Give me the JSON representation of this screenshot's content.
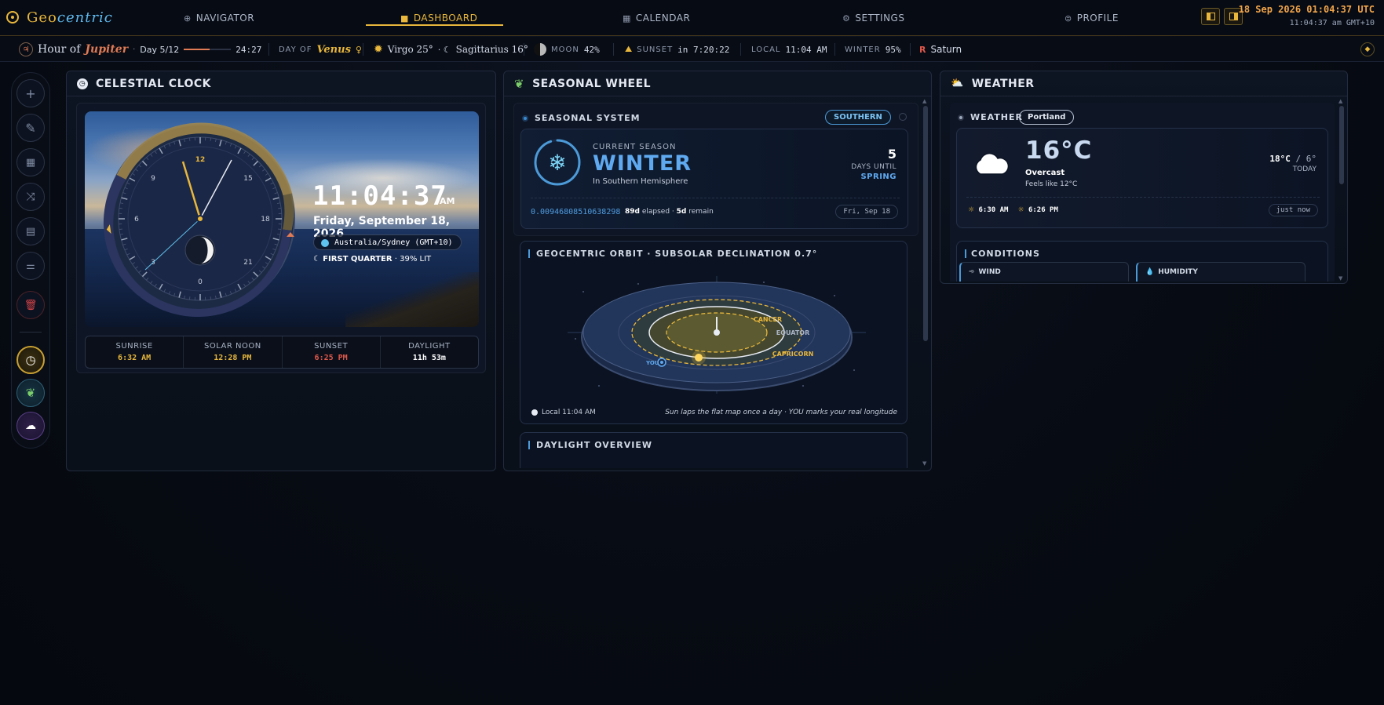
{
  "brand": {
    "part1": "Geo",
    "part2": "centric"
  },
  "nav": {
    "items": [
      {
        "label": "NAVIGATOR",
        "icon": "globe-icon"
      },
      {
        "label": "DASHBOARD",
        "icon": "dashboard-icon",
        "active": true
      },
      {
        "label": "CALENDAR",
        "icon": "calendar-icon"
      },
      {
        "label": "SETTINGS",
        "icon": "gear-icon"
      },
      {
        "label": "PROFILE",
        "icon": "profile-icon"
      }
    ],
    "utc_time": "18 Sep 2026 01:04:37 UTC",
    "local_time": "11:04:37 am GMT+10"
  },
  "status": {
    "hour_label": "Hour of",
    "hour_planet": "Jupiter",
    "day_count": "Day 5/12",
    "hour_progress": 0.55,
    "hour_remaining": "24:27",
    "day_of_label": "DAY OF",
    "day_of_planet": "Venus",
    "venus_glyph": "♀",
    "sun_sign": "Virgo 25°",
    "moon_sign": "Sagittarius 16°",
    "moon_label": "MOON",
    "moon_value": "42%",
    "sunset_label": "SUNSET",
    "sunset_value": "in 7:20:22",
    "local_label": "LOCAL",
    "local_value": "11:04 AM",
    "season_label": "WINTER",
    "season_value": "95%",
    "retro_glyph": "R",
    "retro_planet": "Saturn"
  },
  "panels": {
    "clock": {
      "title": "CELESTIAL CLOCK",
      "time": "11:04:37",
      "ampm": "AM",
      "date": "Friday, September 18, 2026",
      "timezone": "Australia/Sydney (GMT+10)",
      "moon_phase": "FIRST QUARTER",
      "moon_lit": "· 39% LIT",
      "dial_labels": [
        "12",
        "15",
        "18",
        "21",
        "0",
        "3",
        "6",
        "9"
      ],
      "stats": [
        {
          "label": "SUNRISE",
          "value": "6:32 AM",
          "color": "#e8b73c"
        },
        {
          "label": "SOLAR NOON",
          "value": "12:28 PM",
          "color": "#e8b73c"
        },
        {
          "label": "SUNSET",
          "value": "6:25 PM",
          "color": "#e0584a"
        },
        {
          "label": "DAYLIGHT",
          "value": "11h 53m",
          "color": "#ffffff"
        }
      ]
    },
    "season": {
      "title": "SEASONAL WHEEL",
      "system_title": "SEASONAL SYSTEM",
      "hemisphere_pill": "SOUTHERN",
      "kicker": "CURRENT SEASON",
      "name": "WINTER",
      "sub": "In Southern Hemisphere",
      "progress": 0.95,
      "days_until": "5",
      "days_until_label": "DAYS UNTIL",
      "next_season": "SPRING",
      "fraction": "0.00946808510638298",
      "elapsed": "89d",
      "elapsed_label": "elapsed ·",
      "remain": "5d",
      "remain_label": "remain",
      "date_pill": "Fri, Sep 18",
      "orbit_title": "GEOCENTRIC ORBIT · SUBSOLAR DECLINATION 0.7°",
      "orbit_labels": {
        "cancer": "CANCER",
        "equator": "EQUATOR",
        "capricorn": "CAPRICORN",
        "you": "YOU"
      },
      "orbit_local": "Local 11:04 AM",
      "orbit_note": "Sun laps the flat map once a day · YOU marks your real longitude",
      "daylight_title": "DAYLIGHT OVERVIEW"
    },
    "weather": {
      "title": "WEATHER",
      "section_title": "WEATHER",
      "city": "Portland",
      "temp": "16°C",
      "condition": "Overcast",
      "feels_like": "Feels like 12°C",
      "hi": "18°C",
      "lo": "/ 6°",
      "hilo_label": "TODAY",
      "sunrise": "6:30 AM",
      "sunset": "6:26 PM",
      "updated": "just now",
      "conditions_title": "CONDITIONS",
      "wind_label": "WIND",
      "humidity_label": "HUMIDITY"
    }
  },
  "colors": {
    "accent": "#e8b73c",
    "blue": "#5fa9f0",
    "panel_border": "#222c3f"
  }
}
